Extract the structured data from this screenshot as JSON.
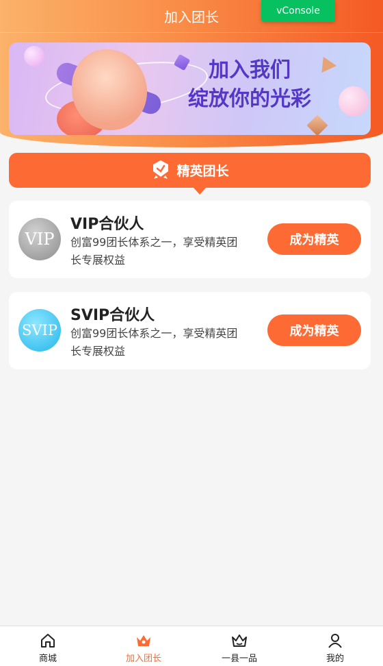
{
  "header": {
    "title": "加入团长",
    "vconsole_label": "vConsole"
  },
  "banner": {
    "line1": "加入我们",
    "line2": "绽放你的光彩"
  },
  "section": {
    "title": "精英团长"
  },
  "cards": [
    {
      "badge": "VIP",
      "name": "VIP合伙人",
      "description": "创富99团长体系之一，享受精英团长专展权益",
      "button": "成为精英"
    },
    {
      "badge": "SVIP",
      "name": "SVIP合伙人",
      "description": "创富99团长体系之一，享受精英团长专展权益",
      "button": "成为精英"
    }
  ],
  "tabbar": {
    "items": [
      {
        "label": "商城",
        "icon": "home-icon",
        "active": false
      },
      {
        "label": "加入团长",
        "icon": "crown-icon",
        "active": true
      },
      {
        "label": "一县一品",
        "icon": "crown-outline-icon",
        "active": false
      },
      {
        "label": "我的",
        "icon": "user-icon",
        "active": false
      }
    ]
  },
  "colors": {
    "accent": "#fe6a33",
    "vconsole": "#07c160",
    "background": "#f5f5f5"
  }
}
